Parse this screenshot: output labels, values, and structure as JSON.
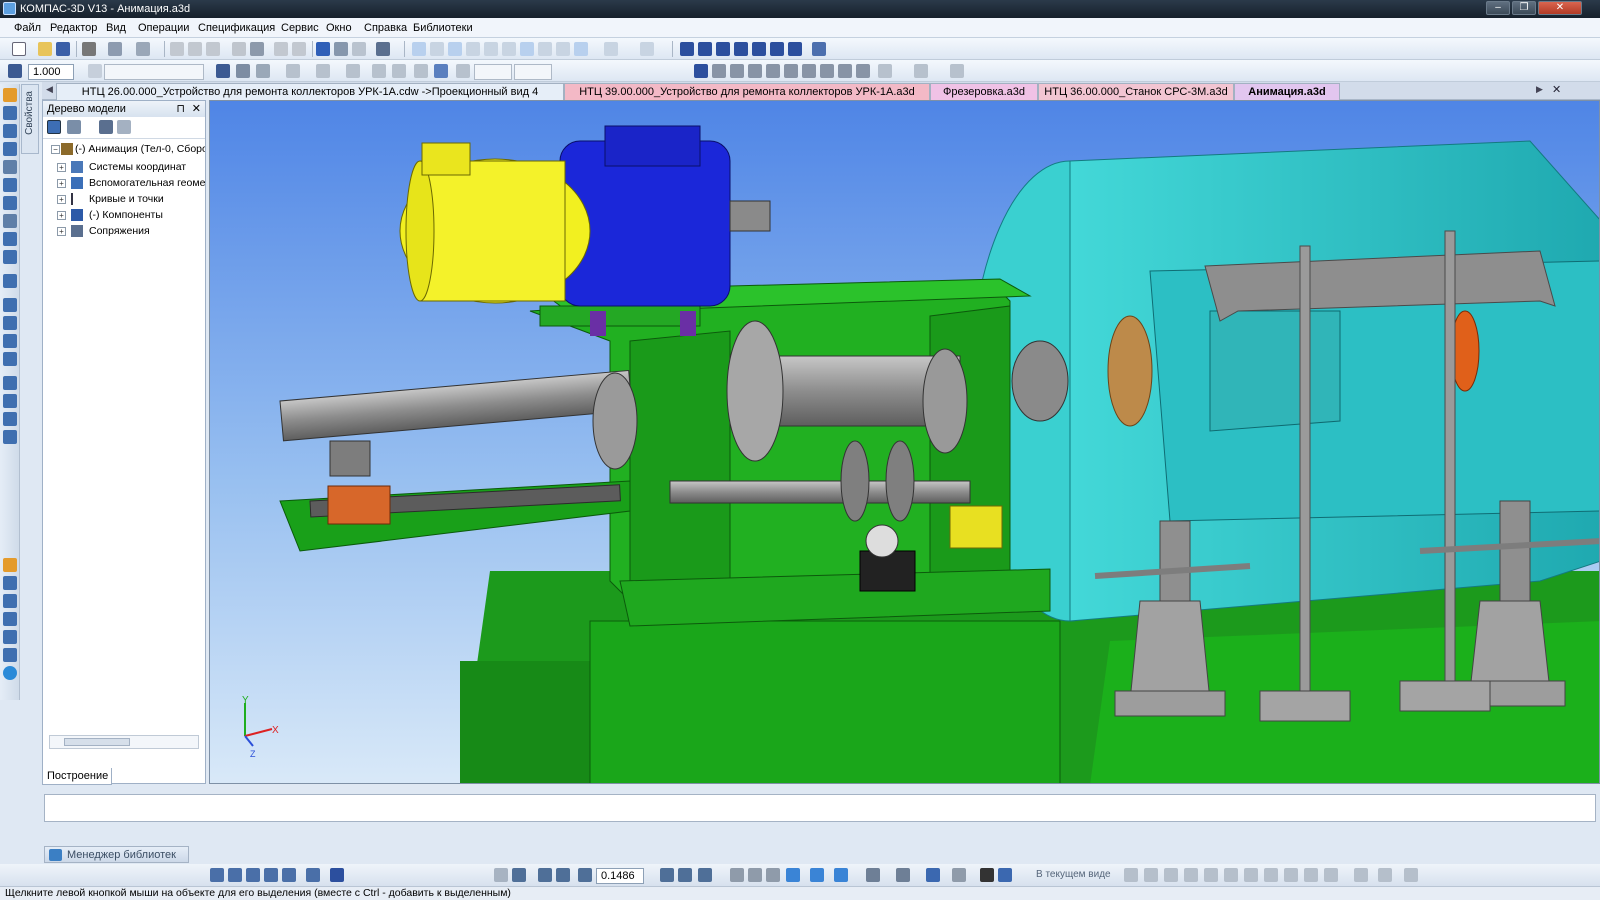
{
  "window": {
    "title": "КОМПАС-3D V13 - Анимация.a3d",
    "minimize": "–",
    "restore": "❐",
    "close": "✕"
  },
  "menu": [
    "Файл",
    "Редактор",
    "Вид",
    "Операции",
    "Спецификация",
    "Сервис",
    "Окно",
    "Справка",
    "Библиотеки"
  ],
  "toolbar2": {
    "scale_value": "1.000"
  },
  "side_tab": {
    "label": "Свойства"
  },
  "tree": {
    "header": "Дерево модели",
    "pin": "⊓",
    "close": "✕",
    "nodes": [
      {
        "label": "(-) Анимация (Тел-0, Сборо",
        "expander": "−"
      },
      {
        "label": "Системы координат",
        "expander": "+"
      },
      {
        "label": "Вспомогательная геоме",
        "expander": "+"
      },
      {
        "label": "Кривые и точки",
        "expander": "+"
      },
      {
        "label": "(-) Компоненты",
        "expander": "+"
      },
      {
        "label": "Сопряжения",
        "expander": "+"
      }
    ],
    "bottom_tab": "Построение"
  },
  "tabs": [
    {
      "label": "НТЦ 26.00.000_Устройство для ремонта коллекторов УРК-1А.cdw ->Проекционный вид 4",
      "color": "#e6eef8",
      "active": false
    },
    {
      "label": "НТЦ 39.00.000_Устройство для ремонта коллекторов УРК-1А.a3d",
      "color": "#f3b9c6",
      "active": false
    },
    {
      "label": "Фрезеровка.a3d",
      "color": "#f0c2e6",
      "active": false
    },
    {
      "label": "НТЦ 36.00.000_Станок СРС-3М.a3d",
      "color": "#f2c5d2",
      "active": false
    },
    {
      "label": "Анимация.a3d",
      "color": "#e2c6ef",
      "active": true
    }
  ],
  "tab_nav": {
    "left": "◀",
    "right": "▶",
    "close": "✕"
  },
  "axis": {
    "x": "X",
    "y": "Y",
    "z": "Z"
  },
  "libmanager": {
    "label": "Менеджер библиотек"
  },
  "bottom_toolbar": {
    "zoom_value": "0.1486",
    "view_label": "В текущем виде"
  },
  "status": {
    "text": "Щелкните левой кнопкой мыши на объекте для его выделения (вместе с Ctrl - добавить к выделенным)"
  },
  "colors": {
    "accent": "#3b7fc4",
    "viewport_top": "#5b8ee8",
    "viewport_bottom": "#cfe2f6",
    "frame": "#1fa41f",
    "motor": "#1020d8",
    "housing": "#2ec8c8"
  }
}
